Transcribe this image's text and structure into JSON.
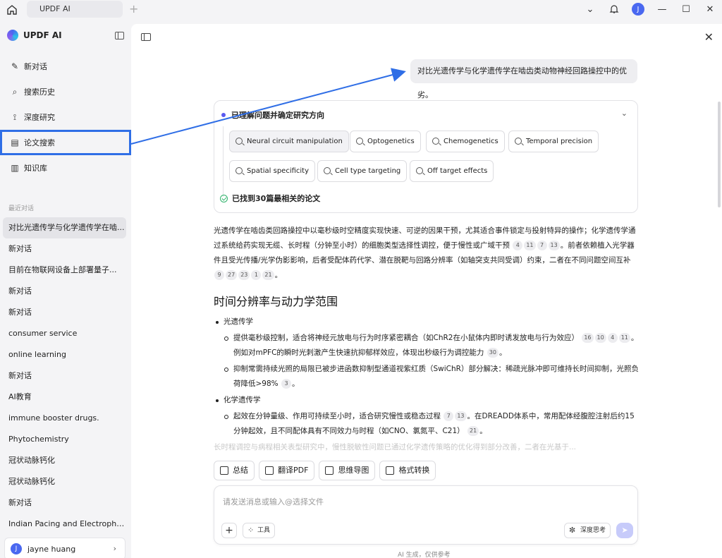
{
  "titlebar": {
    "tab_label": "UPDF AI",
    "avatar_initial": "J",
    "icons": [
      "home-icon",
      "plus-icon",
      "chevron-down-icon",
      "bell-icon",
      "minimize-icon",
      "maximize-icon",
      "close-icon"
    ]
  },
  "sidebar": {
    "brand": "UPDF AI",
    "nav": [
      {
        "label": "新对话",
        "icon": "edit-icon"
      },
      {
        "label": "搜索历史",
        "icon": "search-icon"
      },
      {
        "label": "深度研究",
        "icon": "telescope-icon"
      },
      {
        "label": "论文搜索",
        "icon": "paper-search-icon"
      },
      {
        "label": "知识库",
        "icon": "book-icon"
      }
    ],
    "recent_label": "最近对话",
    "recent": [
      "对比光遗传学与化学遗传学在啮...",
      "新对话",
      "目前在物联网设备上部署量子...",
      "新对话",
      "新对话",
      "consumer service",
      "online learning",
      "新对话",
      "AI教育",
      "immune booster drugs.",
      "Phytochemistry",
      "冠状动脉钙化",
      "冠状动脉钙化",
      "新对话",
      "Indian Pacing and Electrophy..."
    ],
    "user": {
      "initial": "J",
      "name": "jayne huang"
    }
  },
  "main": {
    "user_message": "对比光遗传学与化学遗传学在啮齿类动物神经回路操控中的优劣。",
    "research": {
      "heading": "已理解问题并确定研究方向",
      "chips": [
        "Neural circuit manipulation",
        "Optogenetics",
        "Chemogenetics",
        "Temporal precision",
        "Spatial specificity",
        "Cell type targeting",
        "Off target effects"
      ],
      "found_prefix": "已找到 ",
      "found_count": "30",
      "found_suffix": " 篇最相关的论文"
    },
    "answer": {
      "p1_a": "光遗传学在啮齿类回路操控中以毫秒级时空精度实现快速、可逆的因果干预，尤其适合事件锁定与投射特异的操作；化学遗传学通过系统给药实现无缆、长时程（分钟至小时）的细胞类型选择性调控，便于慢性或广域干预",
      "p1_c1": [
        "4",
        "11",
        "7",
        "13"
      ],
      "p1_b": "。前者依赖植入光学器件且受光传播/光学伪影影响，后者受配体药代学、潜在脱靶与回路分辨率（如轴突支共同受调）约束，二者在不同问题空间互补",
      "p1_c2": [
        "9",
        "27",
        "23",
        "1",
        "21"
      ],
      "p1_end": "。"
    },
    "section_title": "时间分辨率与动力学范围",
    "bullets": {
      "opto": "光遗传学",
      "opto_1": "提供毫秒级控制，适合将神经元放电与行为时序紧密耦合（如ChR2在小鼠体内即时诱发放电与行为效应）",
      "opto_1_c": [
        "16",
        "10",
        "4",
        "11"
      ],
      "opto_1b": "。例如对mPFC的瞬时光刺激产生快速抗抑郁样效应，体现出秒级行为调控能力",
      "opto_1b_c": [
        "30"
      ],
      "opto_2": "抑制常需持续光照的局限已被步进函数抑制型通道视紫红质（SwiChR）部分解决：稀疏光脉冲即可维持长时间抑制，光照负荷降低>98%",
      "opto_2_c": [
        "3"
      ],
      "chemo": "化学遗传学",
      "chemo_1": "起效在分钟量级、作用可持续至小时，适合研究慢性或稳态过程",
      "chemo_1_c": [
        "7",
        "13"
      ],
      "chemo_1b": "。在DREADD体系中，常用配体经腹腔注射后约15分钟起效，且不同配体具有不同效力与时程（如CNO、氯氮平、C21）",
      "chemo_1b_c": [
        "21"
      ],
      "faded": "长时程调控与病程相关表型研究中，慢性脱敏性问题已通过化学遗传策略的优化得到部分改善，二者在光基于..."
    },
    "actions": [
      "总结",
      "翻译PDF",
      "思维导图",
      "格式转换"
    ],
    "composer": {
      "placeholder": "请发送消息或输入@选择文件",
      "tools_label": "工具",
      "deep_label": "深度思考"
    },
    "footer": "AI 生成，仅供参考"
  },
  "colors": {
    "accent": "#4a68f0",
    "annotation": "#2f6ee6",
    "send_disabled": "#c7cbfa"
  }
}
